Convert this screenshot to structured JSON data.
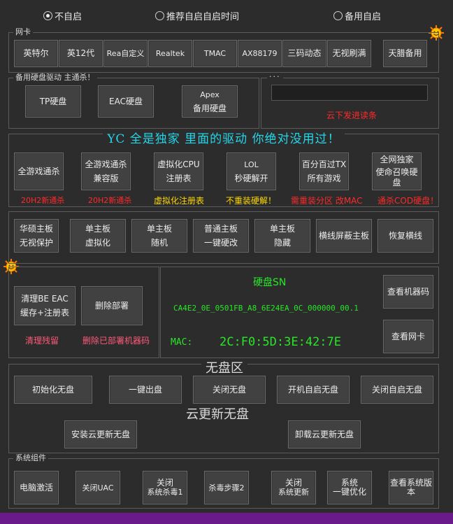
{
  "colors": {
    "accent_red": "#ff2a2a",
    "accent_yellow": "#ffd800",
    "accent_green": "#27e627",
    "accent_cyan": "#22d7ea",
    "bottom_bar": "#6a1a8a"
  },
  "radios": [
    {
      "label": "不自启",
      "checked": true
    },
    {
      "label": "推荐自启自启时间",
      "checked": false
    },
    {
      "label": "备用自启",
      "checked": false
    }
  ],
  "netcard": {
    "title": "网卡",
    "buttons": [
      "英特尔",
      "英12代",
      "Rea自定义",
      "Realtek",
      "TMAC",
      "AX88179",
      "三码动态",
      "无视刷满",
      "天腊备用"
    ]
  },
  "disk": {
    "title": "备用硬盘驱动 主通杀！",
    "tp": "TP硬盘",
    "eac": "EAC硬盘",
    "apex1": "Apex",
    "apex2": "备用硬盘",
    "dots": "···",
    "cloud_msg": "云下发进读条",
    "input_value": ""
  },
  "yc": {
    "title": "YC 全是独家 里面的驱动 你绝对没用过！",
    "buttons": [
      {
        "l1": "全游戏通杀",
        "l2": ""
      },
      {
        "l1": "全游戏通杀",
        "l2": "兼容版"
      },
      {
        "l1": "虚拟化CPU",
        "l2": "注册表"
      },
      {
        "l1": "LOL",
        "l2": "秒硬解开"
      },
      {
        "l1": "百分百过TX",
        "l2": "所有游戏"
      },
      {
        "l1": "全网独家",
        "l2": "使命召唤硬盘"
      }
    ],
    "notes": [
      "20H2新通杀",
      "20H2新通杀",
      "虚拟化注册表",
      "不重装硬解！",
      "需重装分区 改MAC",
      "通杀COD硬盘！"
    ]
  },
  "mobo": {
    "buttons": [
      {
        "l1": "华硕主板",
        "l2": "无视保护"
      },
      {
        "l1": "单主板",
        "l2": "虚拟化"
      },
      {
        "l1": "单主板",
        "l2": "随机"
      },
      {
        "l1": "普通主板",
        "l2": "一键硬改"
      },
      {
        "l1": "单主板",
        "l2": "隐藏"
      },
      {
        "l1": "横线屏蔽主板",
        "l2": ""
      },
      {
        "l1": "恢复横线",
        "l2": ""
      }
    ]
  },
  "clean": {
    "btn1_l1": "清理BE EAC",
    "btn1_l2": "缓存+注册表",
    "btn2": "删除部署",
    "note1": "清理残留",
    "note2": "删除已部署机器码"
  },
  "sn": {
    "title": "硬盘SN",
    "value": "CA4E2_0E_0501FB_A8_6E24EA_0C_000000_00.1",
    "mac_label": "MAC:",
    "mac_value": "2C:F0:5D:3E:42:7E",
    "btn_machine": "查看机器码",
    "btn_netcard": "查看网卡"
  },
  "diskless": {
    "title": "无盘区",
    "buttons": [
      "初始化无盘",
      "一键出盘",
      "关闭无盘",
      "开机自启无盘",
      "关闭自启无盘"
    ],
    "cloud_title": "云更新无盘",
    "install": "安装云更新无盘",
    "uninstall": "卸载云更新无盘"
  },
  "sys": {
    "title": "系统组件",
    "buttons": [
      {
        "l1": "电脑激活",
        "l2": ""
      },
      {
        "l1": "关闭UAC",
        "l2": ""
      },
      {
        "l1": "关闭",
        "l2": "系统杀毒1"
      },
      {
        "l1": "杀毒步骤2",
        "l2": ""
      },
      {
        "l1": "关闭",
        "l2": "系统更新"
      },
      {
        "l1": "系统",
        "l2": "一键优化"
      },
      {
        "l1": "查看系统版",
        "l2": "本"
      }
    ]
  }
}
